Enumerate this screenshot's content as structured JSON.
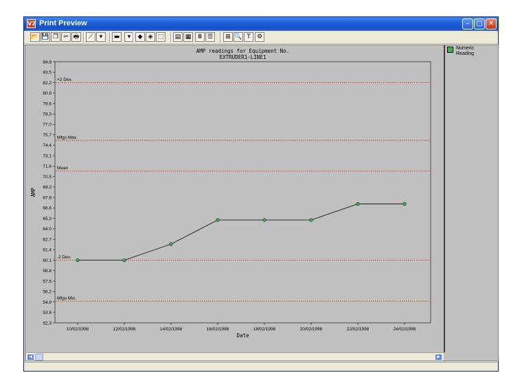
{
  "window": {
    "title": "Print Preview",
    "app_icon_text": "V2",
    "controls": {
      "minimize": "–",
      "maximize": "□",
      "close": "✕"
    }
  },
  "toolbar": {
    "buttons": [
      {
        "name": "open-icon",
        "glyph": "📂"
      },
      {
        "name": "save-icon",
        "glyph": "💾"
      },
      {
        "name": "copy-icon",
        "glyph": "❐"
      },
      {
        "name": "cut-icon",
        "glyph": "✂"
      },
      {
        "name": "print-icon",
        "glyph": "🖶"
      },
      {
        "name": "chart-type-icon",
        "glyph": "⟋"
      },
      {
        "name": "chart-type-dropdown-icon",
        "glyph": "▾"
      },
      {
        "name": "color-bar-icon",
        "glyph": "▬"
      },
      {
        "name": "color-dropdown-icon",
        "glyph": "▾"
      },
      {
        "name": "view-3d-icon",
        "glyph": "◆"
      },
      {
        "name": "rotate-icon",
        "glyph": "◈"
      },
      {
        "name": "zoom-page-icon",
        "glyph": "⬚"
      },
      {
        "name": "page-setup-icon",
        "glyph": "▤"
      },
      {
        "name": "data-table-icon",
        "glyph": "▦"
      },
      {
        "name": "grid-vertical-icon",
        "glyph": "Ⅲ"
      },
      {
        "name": "grid-horizontal-icon",
        "glyph": "☰"
      },
      {
        "name": "axis-icon",
        "glyph": "⊞"
      },
      {
        "name": "zoom-icon",
        "glyph": "🔍"
      },
      {
        "name": "text-icon",
        "glyph": "T"
      },
      {
        "name": "tools-icon",
        "glyph": "⚙"
      }
    ]
  },
  "legend": {
    "label": "Numeric Reading",
    "color": "#39b54a"
  },
  "reference_lines": [
    {
      "label": "+2 Dev.",
      "value": 82.2
    },
    {
      "label": "Mfgs Max.",
      "value": 75.0
    },
    {
      "label": "Mean",
      "value": 71.2
    },
    {
      "label": "-2 Dev.",
      "value": 60.1
    },
    {
      "label": "Mfgs Min.",
      "value": 55.0
    }
  ],
  "chart_data": {
    "type": "line",
    "title": "AMP readings for Equipment No.",
    "subtitle": "EXTRUDER1-LINE1",
    "xlabel": "Date",
    "ylabel": "AMP",
    "ylim": [
      52.3,
      84.8
    ],
    "yticks": [
      "84.8",
      "83.5",
      "82.2",
      "80.9",
      "79.6",
      "78.3",
      "77.0",
      "75.7",
      "74.4",
      "73.1",
      "71.8",
      "70.5",
      "69.2",
      "67.9",
      "66.6",
      "65.3",
      "64.0",
      "62.7",
      "61.4",
      "60.1",
      "58.8",
      "57.5",
      "56.2",
      "54.9",
      "53.6",
      "52.3"
    ],
    "categories": [
      "10/02/1998",
      "12/02/1998",
      "14/02/1998",
      "16/02/1998",
      "18/02/1998",
      "20/02/1998",
      "22/02/1998",
      "24/02/1998"
    ],
    "series": [
      {
        "name": "Numeric Reading",
        "values": [
          60.1,
          60.1,
          62.1,
          65.1,
          65.1,
          65.1,
          67.1,
          67.1
        ],
        "color": "#39b54a"
      }
    ],
    "grid": false,
    "legend_position": "right"
  }
}
